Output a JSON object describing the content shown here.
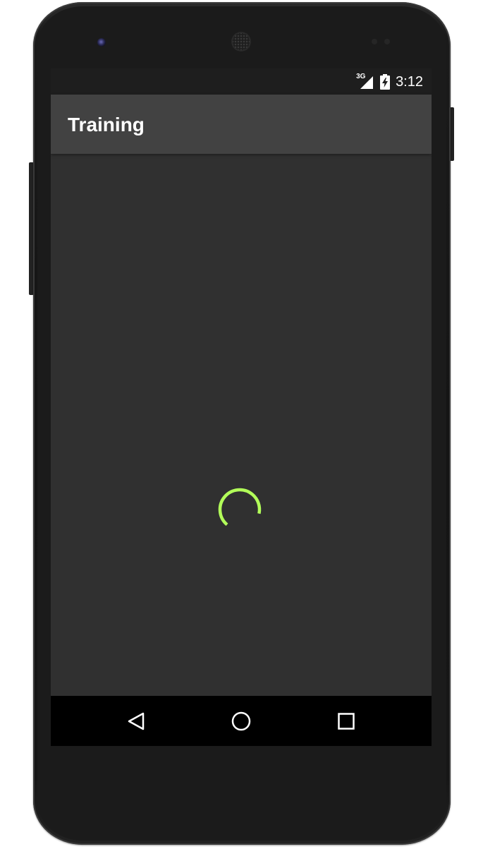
{
  "status_bar": {
    "network_type": "3G",
    "time": "3:12",
    "icons": [
      "cell-signal-icon",
      "battery-charging-icon"
    ]
  },
  "toolbar": {
    "title": "Training",
    "background_color": "#424242"
  },
  "content": {
    "background_color": "#303030",
    "spinner_color": "#b2ff59",
    "spinner_icon": "progress-spinner-icon"
  },
  "nav_bar": {
    "buttons": [
      "back-icon",
      "home-icon",
      "recent-apps-icon"
    ]
  }
}
